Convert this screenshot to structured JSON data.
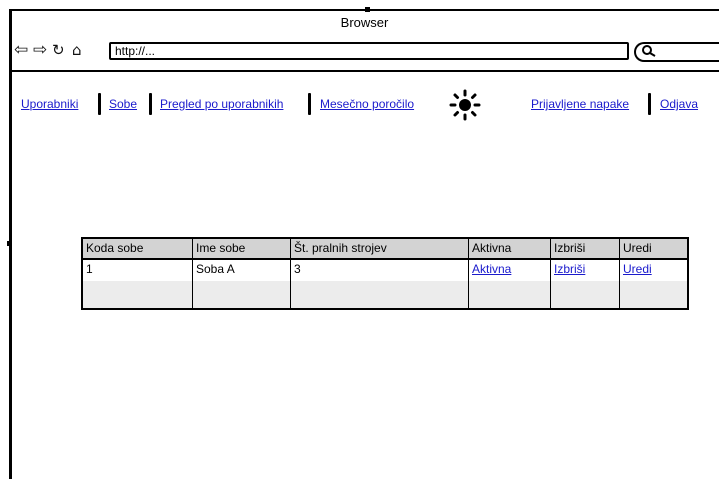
{
  "browser": {
    "title": "Browser",
    "url": "http://...",
    "back_icon": "back-arrow-icon",
    "forward_icon": "forward-arrow-icon",
    "reload_icon": "reload-icon",
    "home_icon": "home-icon",
    "search_icon": "search-icon"
  },
  "nav": {
    "uporabniki": "Uporabniki",
    "sobe": "Sobe",
    "pregled": "Pregled po uporabnikih",
    "porocilo": "Mesečno poročilo",
    "napake": "Prijavljene napake",
    "odjava": "Odjava"
  },
  "table": {
    "headers": [
      "Koda sobe",
      "Ime sobe",
      "Št. pralnih strojev",
      "Aktivna",
      "Izbriši",
      "Uredi"
    ],
    "rows": [
      [
        "1",
        "Soba A",
        "3",
        "Aktivna",
        "Izbriši",
        "Uredi"
      ]
    ]
  },
  "colors": {
    "link": "#1a1acc",
    "header_bg": "#d3d3d3",
    "alt_row_bg": "#ececec"
  }
}
